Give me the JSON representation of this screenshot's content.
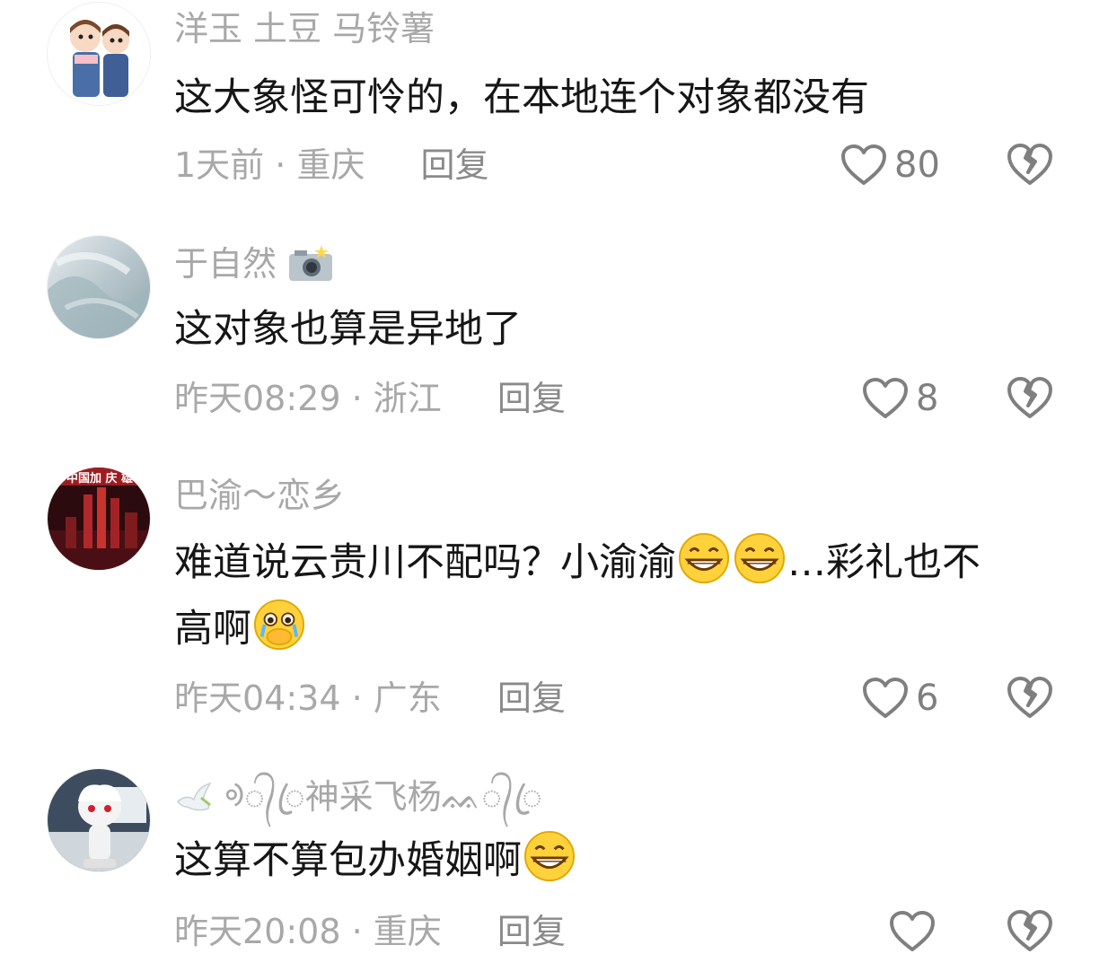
{
  "comments": [
    {
      "username": "洋玉 土豆 马铃薯",
      "text_parts": [
        "这大象怪可怜的，在本地连个对象都没有"
      ],
      "time": "1天前",
      "location": "重庆",
      "reply_label": "回复",
      "likes": "80",
      "avatar_icon": "cartoon-kids-avatar"
    },
    {
      "username": "于自然",
      "username_icon": "camera-flash-icon",
      "text_parts": [
        "这对象也算是异地了"
      ],
      "time": "昨天08:29",
      "location": "浙江",
      "reply_label": "回复",
      "likes": "8",
      "avatar_icon": "blurred-photo-avatar"
    },
    {
      "username": "巴渝～恋乡",
      "text_parts": [
        "难道说云贵川不配吗？小渝渝",
        "…彩礼也不",
        "高啊"
      ],
      "time": "昨天04:34",
      "location": "广东",
      "reply_label": "回复",
      "likes": "6",
      "avatar_icon": "city-night-avatar",
      "avatar_text": "中国加 庆 雄"
    },
    {
      "username": "ᢀ᭄ꦿ神采飞杨ᨐ᭄ꦿ",
      "text_parts": [
        "这算不算包办婚姻啊"
      ],
      "time": "昨天20:08",
      "location": "重庆",
      "reply_label": "回复",
      "likes": "",
      "avatar_icon": "white-figure-avatar"
    }
  ],
  "separator": " · ",
  "colors": {
    "text": "#161616",
    "meta": "#a8a8a8",
    "icon": "#8a8a8a"
  }
}
